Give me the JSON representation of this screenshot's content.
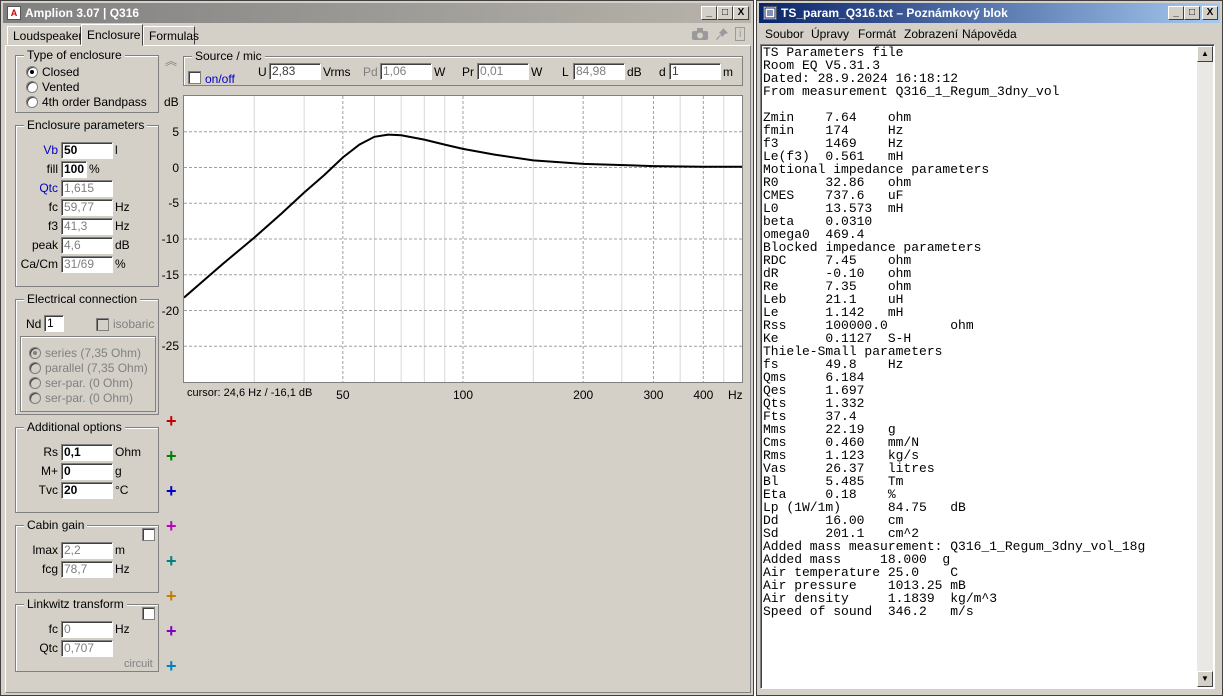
{
  "amplion": {
    "title": "Amplion 3.07  |  Q316",
    "icon_letter": "A",
    "caption_buttons": [
      "_",
      "□",
      "X"
    ],
    "tabs": [
      "Loudspeaker",
      "Enclosure",
      "Formulas"
    ],
    "selected_tab": "Enclosure",
    "toolbar_icons": [
      "camera-icon",
      "pin-icon",
      "info-icon"
    ],
    "info_glyph": "i",
    "enclosure_type": {
      "legend": "Type of enclosure",
      "options": [
        "Closed",
        "Vented",
        "4th order Bandpass"
      ],
      "selected": "Closed"
    },
    "enclosure_params": {
      "legend": "Enclosure parameters",
      "rows": [
        {
          "label": "Vb",
          "value": "50",
          "unit": "l"
        },
        {
          "label": "fill",
          "value": "100",
          "unit": "%"
        },
        {
          "label": "Qtc",
          "value": "1,615",
          "unit": ""
        },
        {
          "label": "fc",
          "value": "59,77",
          "unit": "Hz"
        },
        {
          "label": "f3",
          "value": "41,3",
          "unit": "Hz"
        },
        {
          "label": "peak",
          "value": "4,6",
          "unit": "dB"
        },
        {
          "label": "Ca/Cm",
          "value": "31/69",
          "unit": "%"
        }
      ]
    },
    "electrical": {
      "legend": "Electrical connection",
      "nd_label": "Nd",
      "nd_value": "1",
      "isobaric_label": "isobaric",
      "options": [
        "series (7,35 Ohm)",
        "parallel (7,35 Ohm)",
        "ser-par. (0 Ohm)",
        "ser-par. (0 Ohm)"
      ]
    },
    "additional": {
      "legend": "Additional options",
      "rows": [
        {
          "label": "Rs",
          "value": "0,1",
          "unit": "Ohm"
        },
        {
          "label": "M+",
          "value": "0",
          "unit": "g"
        },
        {
          "label": "Tvc",
          "value": "20",
          "unit": "°C"
        }
      ]
    },
    "cabin_gain": {
      "legend": "Cabin gain",
      "rows": [
        {
          "label": "lmax",
          "value": "2,2",
          "unit": "m"
        },
        {
          "label": "fcg",
          "value": "78,7",
          "unit": "Hz"
        }
      ]
    },
    "linkwitz": {
      "legend": "Linkwitz transform",
      "rows": [
        {
          "label": "fc",
          "value": "0",
          "unit": "Hz"
        },
        {
          "label": "Qtc",
          "value": "0,707",
          "unit": ""
        }
      ],
      "circuit_label": "circuit"
    },
    "source": {
      "legend": "Source / mic",
      "onoff_label": "on/off",
      "fields": [
        {
          "label": "U",
          "value": "2,83",
          "unit": "Vrms"
        },
        {
          "label": "Pd",
          "value": "1,06",
          "unit": "W"
        },
        {
          "label": "Pr",
          "value": "0,01",
          "unit": "W"
        },
        {
          "label": "L",
          "value": "84,98",
          "unit": "dB"
        },
        {
          "label": "d",
          "value": "1",
          "unit": "m"
        }
      ]
    },
    "collapse_glyph": "︽",
    "plus_glyph": "+",
    "plus_colors": [
      "#c00000",
      "#008000",
      "#0000c0",
      "#c000c0",
      "#008080",
      "#c08000",
      "#8000c0",
      "#0080c0"
    ],
    "cursor_readout": "cursor: 24,6 Hz / -16,1 dB"
  },
  "chart_data": {
    "type": "line",
    "title": "",
    "xlabel": "Hz",
    "ylabel": "dB",
    "x_scale": "log",
    "xlim": [
      20,
      500
    ],
    "ylim": [
      -30,
      10
    ],
    "x_ticks": [
      50,
      100,
      200,
      300,
      400
    ],
    "y_ticks": [
      5,
      0,
      -5,
      -10,
      -15,
      -20,
      -25
    ],
    "grid": true,
    "series": [
      {
        "x": [
          20,
          25,
          30,
          35,
          40,
          45,
          50,
          55,
          60,
          65,
          70,
          80,
          90,
          100,
          120,
          150,
          200,
          300,
          400,
          500
        ],
        "y": [
          -18.2,
          -13.5,
          -9.8,
          -6.5,
          -3.5,
          -1.0,
          1.4,
          3.2,
          4.3,
          4.6,
          4.5,
          3.9,
          3.2,
          2.6,
          1.8,
          1.0,
          0.5,
          0.2,
          0.1,
          0.1
        ],
        "color": "#000000"
      }
    ]
  },
  "notepad": {
    "title": "TS_param_Q316.txt – Poznámkový blok",
    "caption_buttons": [
      "_",
      "□",
      "X"
    ],
    "scroll_up": "▲",
    "scroll_down": "▼",
    "menu": [
      "Soubor",
      "Úpravy",
      "Formát",
      "Zobrazení",
      "Nápověda"
    ],
    "lines": [
      "TS Parameters file",
      "Room EQ V5.31.3",
      "Dated: 28.9.2024 16:18:12",
      "From measurement Q316_1_Regum_3dny_vol",
      "",
      "Zmin    7.64    ohm",
      "fmin    174     Hz",
      "f3      1469    Hz",
      "Le(f3)  0.561   mH",
      "Motional impedance parameters",
      "R0      32.86   ohm",
      "CMES    737.6   uF",
      "L0      13.573  mH",
      "beta    0.0310",
      "omega0  469.4",
      "Blocked impedance parameters",
      "RDC     7.45    ohm",
      "dR      -0.10   ohm",
      "Re      7.35    ohm",
      "Leb     21.1    uH",
      "Le      1.142   mH",
      "Rss     100000.0        ohm",
      "Ke      0.1127  S-H",
      "Thiele-Small parameters",
      "fs      49.8    Hz",
      "Qms     6.184",
      "Qes     1.697",
      "Qts     1.332",
      "Fts     37.4",
      "Mms     22.19   g",
      "Cms     0.460   mm/N",
      "Rms     1.123   kg/s",
      "Vas     26.37   litres",
      "Bl      5.485   Tm",
      "Eta     0.18    %",
      "Lp (1W/1m)      84.75   dB",
      "Dd      16.00   cm",
      "Sd      201.1   cm^2",
      "Added mass measurement: Q316_1_Regum_3dny_vol_18g",
      "Added mass     18.000  g",
      "Air temperature 25.0    C",
      "Air pressure    1013.25 mB",
      "Air density     1.1839  kg/m^3",
      "Speed of sound  346.2   m/s"
    ]
  }
}
